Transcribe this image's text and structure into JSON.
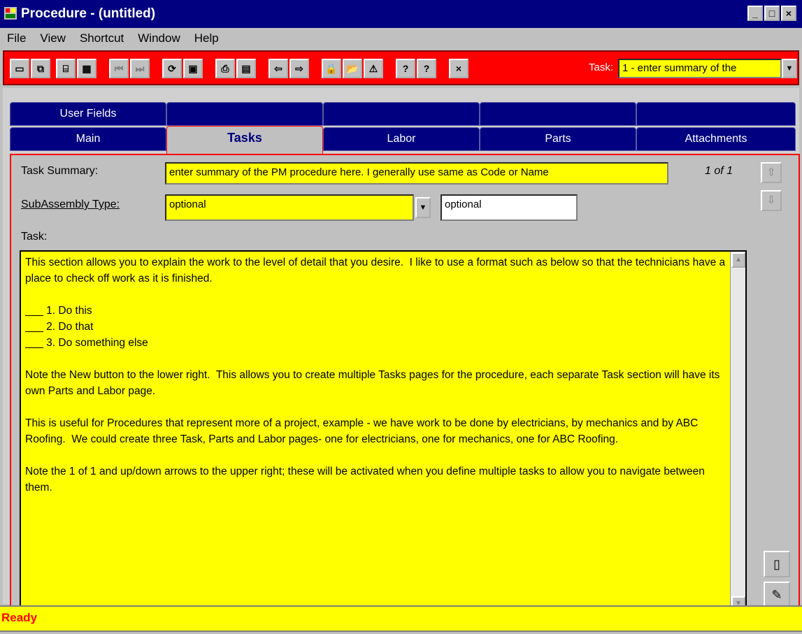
{
  "window": {
    "title": "Procedure - (untitled)",
    "minimize": "_",
    "maximize": "□",
    "close": "×"
  },
  "menu": [
    "File",
    "View",
    "Shortcut",
    "Window",
    "Help"
  ],
  "toolbar": {
    "task_label": "Task:",
    "task_value": "1 - enter summary of the",
    "buttons": [
      {
        "icon": "new-icon",
        "glyph": "▭"
      },
      {
        "icon": "copy-icon",
        "glyph": "⧉"
      },
      {
        "icon": "open-icon",
        "glyph": "⌸"
      },
      {
        "icon": "grid-icon",
        "glyph": "▦"
      },
      {
        "icon": "first-icon",
        "glyph": "⏮"
      },
      {
        "icon": "last-icon",
        "glyph": "⏭"
      },
      {
        "icon": "refresh-icon",
        "glyph": "⟳"
      },
      {
        "icon": "save-icon",
        "glyph": "▣"
      },
      {
        "icon": "print-icon",
        "glyph": "⎙"
      },
      {
        "icon": "preview-icon",
        "glyph": "▤"
      },
      {
        "icon": "back-icon",
        "glyph": "⇦"
      },
      {
        "icon": "forward-icon",
        "glyph": "⇨"
      },
      {
        "icon": "lock-icon",
        "glyph": "🔒"
      },
      {
        "icon": "folder-icon",
        "glyph": "📂"
      },
      {
        "icon": "chart-icon",
        "glyph": "⚠"
      },
      {
        "icon": "help-icon",
        "glyph": "?"
      },
      {
        "icon": "context-help-icon",
        "glyph": "?"
      },
      {
        "icon": "close-icon",
        "glyph": "×"
      }
    ]
  },
  "tabs_top": [
    "User Fields",
    "",
    "",
    "",
    ""
  ],
  "tabs_bottom": [
    "Main",
    "Tasks",
    "Labor",
    "Parts",
    "Attachments"
  ],
  "form": {
    "task_summary_label": "Task Summary:",
    "task_summary_value": "enter summary of the PM procedure here. I generally use same as Code or Name",
    "counter": "1 of 1",
    "subassembly_label": "SubAssembly Type:",
    "subassembly_value": "optional",
    "subassembly_desc": "optional",
    "task_label": "Task:",
    "task_text": "This section allows you to explain the work to the level of detail that you desire.  I like to use a format such as below so that the technicians have a place to check off work as it is finished.\n\n___ 1. Do this\n___ 2. Do that\n___ 3. Do something else\n\nNote the New button to the lower right.  This allows you to create multiple Tasks pages for the procedure, each separate Task section will have its own Parts and Labor page.\n\nThis is useful for Procedures that represent more of a project, example - we have work to be done by electricians, by mechanics and by ABC Roofing.  We could create three Task, Parts and Labor pages- one for electricians, one for mechanics, one for ABC Roofing.\n\nNote the 1 of 1 and up/down arrows to the upper right; these will be activated when you define multiple tasks to allow you to navigate between them."
  },
  "status": "Ready",
  "colors": {
    "toolbar": "#ff0000",
    "field": "#ffff00",
    "tab": "#000080"
  }
}
